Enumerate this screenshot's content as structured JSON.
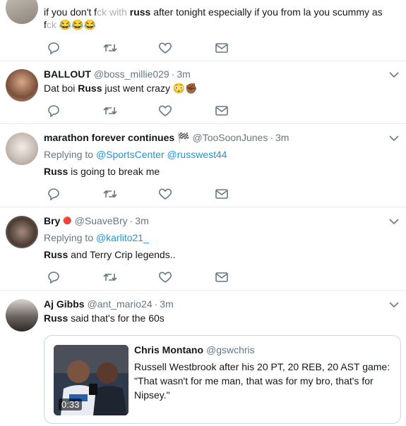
{
  "tweets": [
    {
      "body_pre": "if you don't f",
      "body_censored": "ck with ",
      "body_bold": "russ",
      "body_post": " after tonight especially if you from la you scummy as",
      "body_line2_pre": "f",
      "body_line2_censored": "ck",
      "emojis": [
        "😂",
        "😂",
        "😂"
      ]
    },
    {
      "name": "BALLOUT",
      "handle": "@boss_millie029",
      "time": "3m",
      "body_pre": "Dat boi ",
      "body_bold": "Russ",
      "body_post": " just went crazy",
      "emojis": [
        "😳",
        "✊🏾"
      ]
    },
    {
      "name": "marathon forever continues",
      "name_emoji": "🏁",
      "handle": "@TooSoonJunes",
      "time": "3m",
      "replying_label": "Replying to",
      "reply_to": [
        "@SportsCenter",
        "@russwest44"
      ],
      "body_bold": "Russ",
      "body_post": " is going to break me"
    },
    {
      "name": "Bry",
      "name_emoji": "🔴",
      "handle": "@SuaveBry",
      "time": "3m",
      "replying_label": "Replying to",
      "reply_to": [
        "@karlito21_"
      ],
      "body_bold": "Russ",
      "body_post": " and Terry Crip legends.."
    },
    {
      "name": "Aj Gibbs",
      "handle": "@ant_mario24",
      "time": "3m",
      "body_bold": "Russ",
      "body_post": " said that's for the 60s",
      "quote": {
        "name": "Chris Montano",
        "handle": "@gswchris",
        "text": "Russell Westbrook after his 20 PT, 20 REB, 20 AST game: \"That wasn't for me man, that was for my bro, that's for Nipsey.\"",
        "duration": "0:33"
      }
    }
  ],
  "icons": [
    "reply-icon",
    "retweet-icon",
    "like-icon",
    "message-icon",
    "chevron-down-icon"
  ],
  "colors": {
    "icon": "#657786",
    "link": "#1b95e0",
    "border": "#e6ecf0"
  }
}
